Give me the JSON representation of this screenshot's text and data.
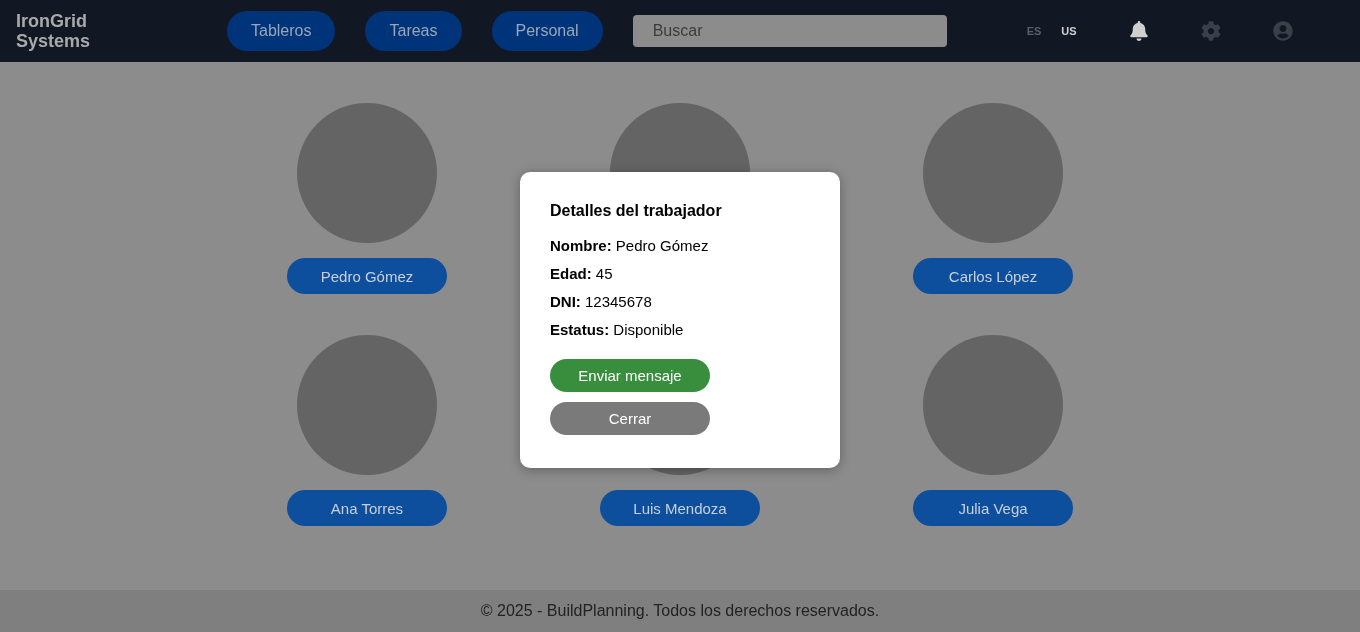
{
  "brand": "IronGrid Systems",
  "nav": [
    "Tableros",
    "Tareas",
    "Personal"
  ],
  "search": {
    "placeholder": "Buscar"
  },
  "languages": [
    {
      "label": "ES",
      "selected": false
    },
    {
      "label": "US",
      "selected": true
    }
  ],
  "workers": [
    {
      "kind": "named",
      "name": "Pedro Gómez"
    },
    {
      "kind": "covered"
    },
    {
      "kind": "named",
      "name": "Carlos López"
    },
    {
      "kind": "named",
      "name": "Ana Torres"
    },
    {
      "kind": "named",
      "name": "Luis Mendoza"
    },
    {
      "kind": "named",
      "name": "Julia Vega"
    }
  ],
  "modal": {
    "title": "Detalles del trabajador",
    "fields": [
      {
        "label": "Nombre:",
        "value": "Pedro Gómez"
      },
      {
        "label": "Edad:",
        "value": "45"
      },
      {
        "label": "DNI:",
        "value": "12345678"
      },
      {
        "label": "Estatus:",
        "value": "Disponible"
      }
    ],
    "buttons": [
      {
        "label": "Enviar mensaje",
        "kind": "primary"
      },
      {
        "label": "Cerrar",
        "kind": "secondary"
      }
    ]
  },
  "footer": "© 2025 - BuildPlanning. Todos los derechos reservados."
}
